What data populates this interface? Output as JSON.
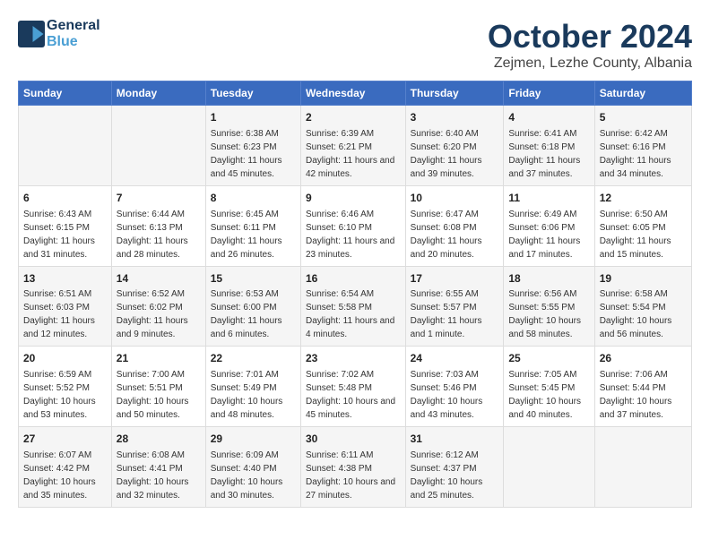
{
  "header": {
    "logo_line1": "General",
    "logo_line2": "Blue",
    "month": "October 2024",
    "location": "Zejmen, Lezhe County, Albania"
  },
  "days_of_week": [
    "Sunday",
    "Monday",
    "Tuesday",
    "Wednesday",
    "Thursday",
    "Friday",
    "Saturday"
  ],
  "weeks": [
    [
      {
        "day": "",
        "content": ""
      },
      {
        "day": "",
        "content": ""
      },
      {
        "day": "1",
        "content": "Sunrise: 6:38 AM\nSunset: 6:23 PM\nDaylight: 11 hours and 45 minutes."
      },
      {
        "day": "2",
        "content": "Sunrise: 6:39 AM\nSunset: 6:21 PM\nDaylight: 11 hours and 42 minutes."
      },
      {
        "day": "3",
        "content": "Sunrise: 6:40 AM\nSunset: 6:20 PM\nDaylight: 11 hours and 39 minutes."
      },
      {
        "day": "4",
        "content": "Sunrise: 6:41 AM\nSunset: 6:18 PM\nDaylight: 11 hours and 37 minutes."
      },
      {
        "day": "5",
        "content": "Sunrise: 6:42 AM\nSunset: 6:16 PM\nDaylight: 11 hours and 34 minutes."
      }
    ],
    [
      {
        "day": "6",
        "content": "Sunrise: 6:43 AM\nSunset: 6:15 PM\nDaylight: 11 hours and 31 minutes."
      },
      {
        "day": "7",
        "content": "Sunrise: 6:44 AM\nSunset: 6:13 PM\nDaylight: 11 hours and 28 minutes."
      },
      {
        "day": "8",
        "content": "Sunrise: 6:45 AM\nSunset: 6:11 PM\nDaylight: 11 hours and 26 minutes."
      },
      {
        "day": "9",
        "content": "Sunrise: 6:46 AM\nSunset: 6:10 PM\nDaylight: 11 hours and 23 minutes."
      },
      {
        "day": "10",
        "content": "Sunrise: 6:47 AM\nSunset: 6:08 PM\nDaylight: 11 hours and 20 minutes."
      },
      {
        "day": "11",
        "content": "Sunrise: 6:49 AM\nSunset: 6:06 PM\nDaylight: 11 hours and 17 minutes."
      },
      {
        "day": "12",
        "content": "Sunrise: 6:50 AM\nSunset: 6:05 PM\nDaylight: 11 hours and 15 minutes."
      }
    ],
    [
      {
        "day": "13",
        "content": "Sunrise: 6:51 AM\nSunset: 6:03 PM\nDaylight: 11 hours and 12 minutes."
      },
      {
        "day": "14",
        "content": "Sunrise: 6:52 AM\nSunset: 6:02 PM\nDaylight: 11 hours and 9 minutes."
      },
      {
        "day": "15",
        "content": "Sunrise: 6:53 AM\nSunset: 6:00 PM\nDaylight: 11 hours and 6 minutes."
      },
      {
        "day": "16",
        "content": "Sunrise: 6:54 AM\nSunset: 5:58 PM\nDaylight: 11 hours and 4 minutes."
      },
      {
        "day": "17",
        "content": "Sunrise: 6:55 AM\nSunset: 5:57 PM\nDaylight: 11 hours and 1 minute."
      },
      {
        "day": "18",
        "content": "Sunrise: 6:56 AM\nSunset: 5:55 PM\nDaylight: 10 hours and 58 minutes."
      },
      {
        "day": "19",
        "content": "Sunrise: 6:58 AM\nSunset: 5:54 PM\nDaylight: 10 hours and 56 minutes."
      }
    ],
    [
      {
        "day": "20",
        "content": "Sunrise: 6:59 AM\nSunset: 5:52 PM\nDaylight: 10 hours and 53 minutes."
      },
      {
        "day": "21",
        "content": "Sunrise: 7:00 AM\nSunset: 5:51 PM\nDaylight: 10 hours and 50 minutes."
      },
      {
        "day": "22",
        "content": "Sunrise: 7:01 AM\nSunset: 5:49 PM\nDaylight: 10 hours and 48 minutes."
      },
      {
        "day": "23",
        "content": "Sunrise: 7:02 AM\nSunset: 5:48 PM\nDaylight: 10 hours and 45 minutes."
      },
      {
        "day": "24",
        "content": "Sunrise: 7:03 AM\nSunset: 5:46 PM\nDaylight: 10 hours and 43 minutes."
      },
      {
        "day": "25",
        "content": "Sunrise: 7:05 AM\nSunset: 5:45 PM\nDaylight: 10 hours and 40 minutes."
      },
      {
        "day": "26",
        "content": "Sunrise: 7:06 AM\nSunset: 5:44 PM\nDaylight: 10 hours and 37 minutes."
      }
    ],
    [
      {
        "day": "27",
        "content": "Sunrise: 6:07 AM\nSunset: 4:42 PM\nDaylight: 10 hours and 35 minutes."
      },
      {
        "day": "28",
        "content": "Sunrise: 6:08 AM\nSunset: 4:41 PM\nDaylight: 10 hours and 32 minutes."
      },
      {
        "day": "29",
        "content": "Sunrise: 6:09 AM\nSunset: 4:40 PM\nDaylight: 10 hours and 30 minutes."
      },
      {
        "day": "30",
        "content": "Sunrise: 6:11 AM\nSunset: 4:38 PM\nDaylight: 10 hours and 27 minutes."
      },
      {
        "day": "31",
        "content": "Sunrise: 6:12 AM\nSunset: 4:37 PM\nDaylight: 10 hours and 25 minutes."
      },
      {
        "day": "",
        "content": ""
      },
      {
        "day": "",
        "content": ""
      }
    ]
  ]
}
